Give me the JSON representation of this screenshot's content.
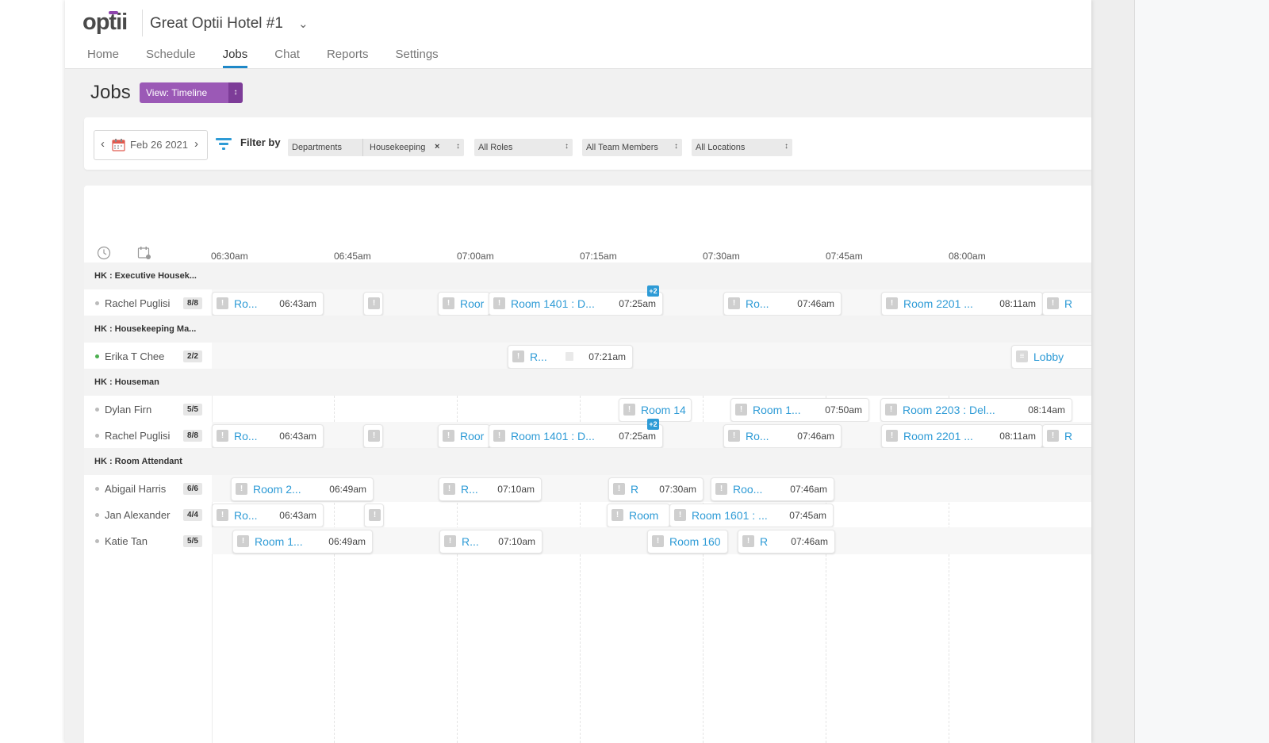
{
  "app": {
    "logo": "optii",
    "hotel_name": "Great Optii Hotel #1",
    "nav": [
      "Home",
      "Schedule",
      "Jobs",
      "Chat",
      "Reports",
      "Settings"
    ],
    "active_nav": "Jobs"
  },
  "page": {
    "title": "Jobs",
    "view_button": "View: Timeline"
  },
  "filters": {
    "date": "Feb 26 2021",
    "filter_label": "Filter by",
    "departments_label": "Departments",
    "department_chip": "Housekeeping",
    "chip_remove": "×",
    "roles": "All Roles",
    "team_members": "All Team Members",
    "locations": "All Locations"
  },
  "timeline": {
    "times": [
      "06:30am",
      "06:45am",
      "07:00am",
      "07:15am",
      "07:30am",
      "07:45am",
      "08:00am"
    ],
    "groups": [
      {
        "name": "HK : Executive Housek...",
        "members": [
          {
            "name": "Rachel Puglisi",
            "count": "8/8",
            "online": false,
            "jobs": [
              {
                "label": "Ro...",
                "time": "06:43am"
              },
              {
                "label": "",
                "time": ""
              },
              {
                "label": "Roor",
                "time": ""
              },
              {
                "label": "Room 1401 : D...",
                "time": "07:25am",
                "badge": "+2"
              },
              {
                "label": "Ro...",
                "time": "07:46am"
              },
              {
                "label": "Room 2201 ...",
                "time": "08:11am"
              },
              {
                "label": "R",
                "time": ""
              }
            ]
          }
        ]
      },
      {
        "name": "HK : Housekeeping Ma...",
        "members": [
          {
            "name": "Erika T Chee",
            "count": "2/2",
            "online": true,
            "jobs": [
              {
                "label": "R...",
                "time": "07:21am"
              },
              {
                "label": "Lobby",
                "time": ""
              }
            ]
          }
        ]
      },
      {
        "name": "HK : Houseman",
        "members": [
          {
            "name": "Dylan Firn",
            "count": "5/5",
            "online": false,
            "jobs": [
              {
                "label": "Room 14",
                "time": ""
              },
              {
                "label": "Room 1...",
                "time": "07:50am"
              },
              {
                "label": "Room 2203 : Del...",
                "time": "08:14am"
              }
            ]
          },
          {
            "name": "Rachel Puglisi",
            "count": "8/8",
            "online": false,
            "jobs": [
              {
                "label": "Ro...",
                "time": "06:43am"
              },
              {
                "label": "",
                "time": ""
              },
              {
                "label": "Roor",
                "time": ""
              },
              {
                "label": "Room 1401 : D...",
                "time": "07:25am",
                "badge": "+2"
              },
              {
                "label": "Ro...",
                "time": "07:46am"
              },
              {
                "label": "Room 2201 ...",
                "time": "08:11am"
              },
              {
                "label": "R",
                "time": ""
              }
            ]
          }
        ]
      },
      {
        "name": "HK : Room Attendant",
        "members": [
          {
            "name": "Abigail Harris",
            "count": "6/6",
            "online": false,
            "jobs": [
              {
                "label": "Room 2...",
                "time": "06:49am"
              },
              {
                "label": "R...",
                "time": "07:10am"
              },
              {
                "label": "R",
                "time": "07:30am"
              },
              {
                "label": "Roo...",
                "time": "07:46am"
              }
            ]
          },
          {
            "name": "Jan Alexander",
            "count": "4/4",
            "online": false,
            "jobs": [
              {
                "label": "Ro...",
                "time": "06:43am"
              },
              {
                "label": "",
                "time": ""
              },
              {
                "label": "Room",
                "time": ""
              },
              {
                "label": "Room 1601 : ...",
                "time": "07:45am"
              }
            ]
          },
          {
            "name": "Katie Tan",
            "count": "5/5",
            "online": false,
            "jobs": [
              {
                "label": "Room 1...",
                "time": "06:49am"
              },
              {
                "label": "R...",
                "time": "07:10am"
              },
              {
                "label": "Room 160",
                "time": ""
              },
              {
                "label": "R",
                "time": "07:46am"
              }
            ]
          }
        ]
      }
    ]
  }
}
